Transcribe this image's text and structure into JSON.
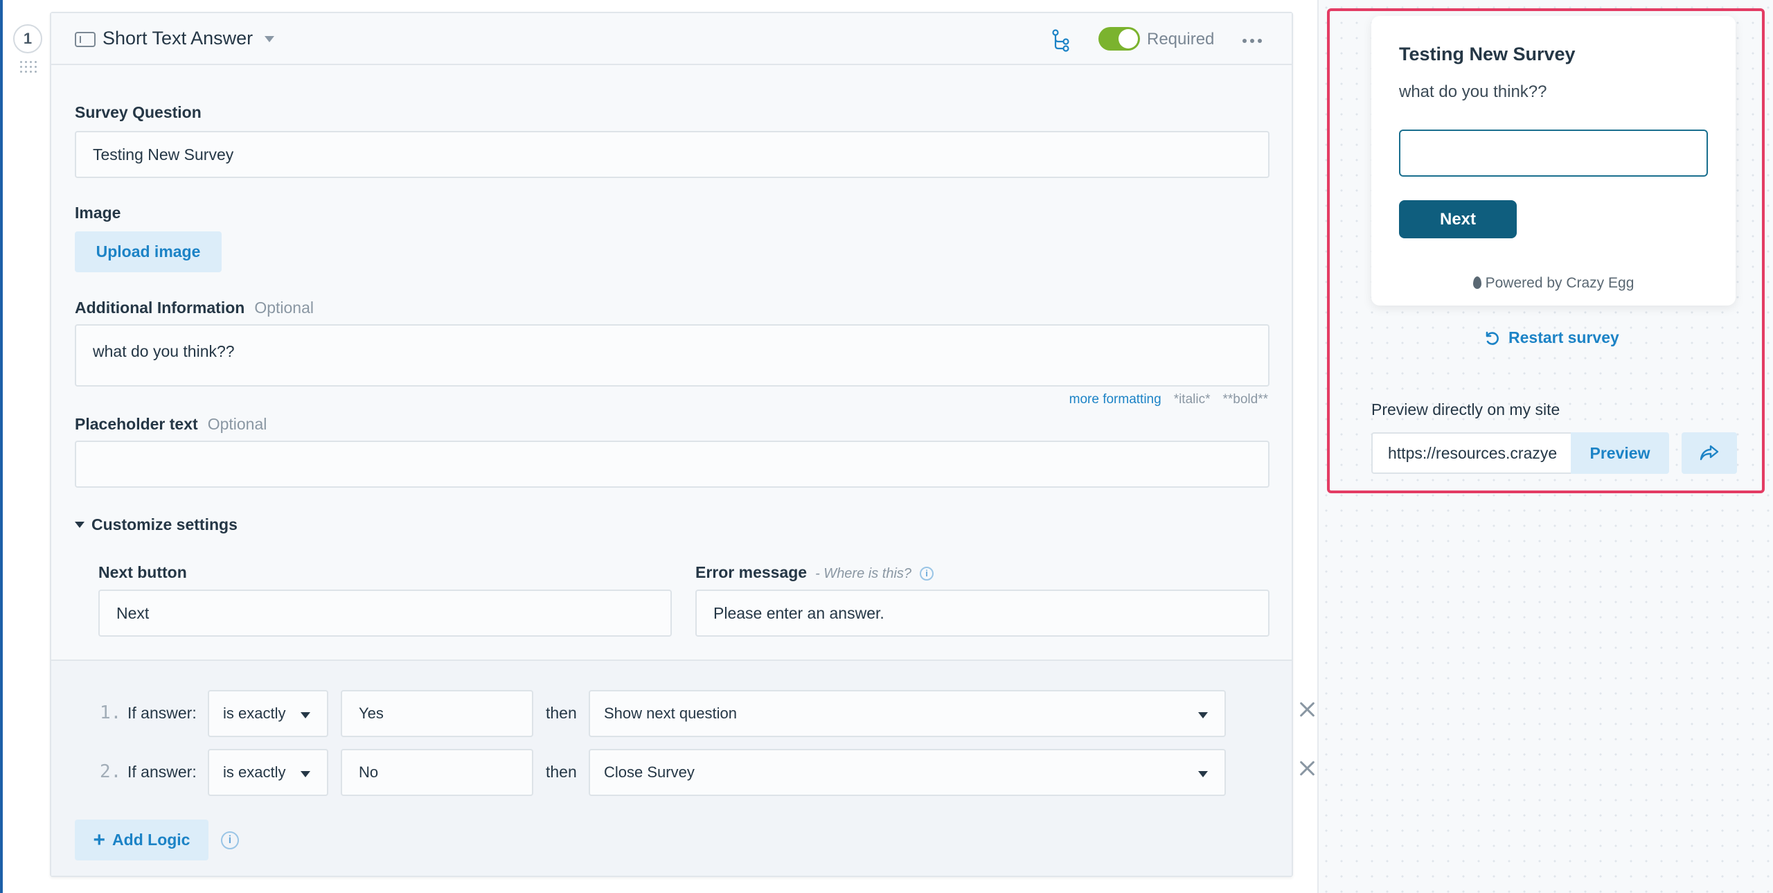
{
  "question": {
    "number": "1",
    "type_label": "Short Text Answer",
    "required_label": "Required",
    "required_on": true
  },
  "fields": {
    "survey_question_label": "Survey Question",
    "survey_question_value": "Testing New Survey",
    "image_label": "Image",
    "upload_button": "Upload image",
    "additional_info_label": "Additional Information",
    "additional_info_optional": "Optional",
    "additional_info_value": "what do you think??",
    "more_formatting": "more formatting",
    "italic_hint": "*italic*",
    "bold_hint": "**bold**",
    "placeholder_label": "Placeholder text",
    "placeholder_optional": "Optional",
    "placeholder_value": ""
  },
  "customize": {
    "label": "Customize settings",
    "next_button_label": "Next button",
    "next_button_value": "Next",
    "error_label": "Error message",
    "error_where": "- Where is this?",
    "error_value": "Please enter an answer."
  },
  "logic": {
    "rules": [
      {
        "num": "1.",
        "if_label": "If answer:",
        "operator": "is exactly",
        "value": "Yes",
        "then": "then",
        "action": "Show next question"
      },
      {
        "num": "2.",
        "if_label": "If answer:",
        "operator": "is exactly",
        "value": "No",
        "then": "then",
        "action": "Close Survey"
      }
    ],
    "add_button": "Add Logic"
  },
  "preview": {
    "survey_title": "Testing New Survey",
    "survey_sub": "what do you think??",
    "next_button": "Next",
    "powered_by": "Powered by Crazy Egg",
    "restart": "Restart survey",
    "site_label": "Preview directly on my site",
    "url_value": "https://resources.crazye",
    "preview_button": "Preview"
  },
  "colors": {
    "accent_blue": "#1c83c6",
    "toggle_green": "#7bb32e",
    "survey_button": "#0f5e7e",
    "highlight_border": "#e33c64"
  }
}
